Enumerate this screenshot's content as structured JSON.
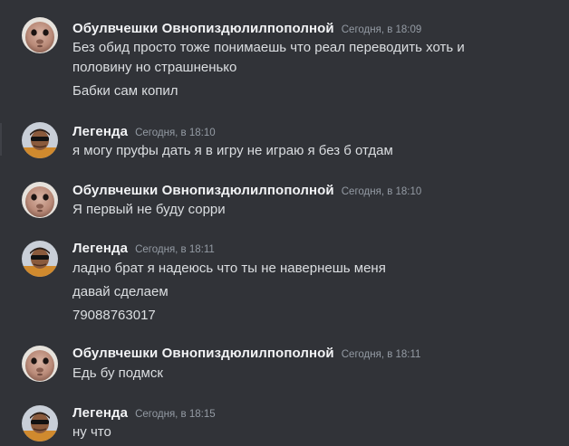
{
  "channel": {
    "messages": [
      {
        "author": "Обулвчешки Овнопиздюлилпополной",
        "timestamp": "Сегодня, в 18:09",
        "lines": [
          "Без обид просто тоже понимаешь что реал переводить хоть и",
          "половину но страшненько",
          "Бабки сам копил"
        ],
        "avatar_icon": "alien-face-avatar-icon"
      },
      {
        "author": "Легенда",
        "timestamp": "Сегодня, в 18:10",
        "lines": [
          "я могу пруфы дать я в игру не играю я без б отдам"
        ],
        "avatar_icon": "person-sunglasses-avatar-icon"
      },
      {
        "author": "Обулвчешки Овнопиздюлилпополной",
        "timestamp": "Сегодня, в 18:10",
        "lines": [
          "Я первый не буду сорри"
        ],
        "avatar_icon": "alien-face-avatar-icon"
      },
      {
        "author": "Легенда",
        "timestamp": "Сегодня, в 18:11",
        "lines": [
          "ладно брат я надеюсь что ты не навернешь меня",
          "давай сделаем",
          "79088763017"
        ],
        "avatar_icon": "person-sunglasses-avatar-icon"
      },
      {
        "author": "Обулвчешки Овнопиздюлилпополной",
        "timestamp": "Сегодня, в 18:11",
        "lines": [
          "Едь бу подмск"
        ],
        "avatar_icon": "alien-face-avatar-icon"
      },
      {
        "author": "Легенда",
        "timestamp": "Сегодня, в 18:15",
        "lines": [
          "ну что"
        ],
        "avatar_icon": "person-sunglasses-avatar-icon"
      }
    ]
  },
  "colors": {
    "background": "#313338",
    "username": "#f2f3f5",
    "timestamp": "#949ba4",
    "message_text": "#dbdee1"
  }
}
